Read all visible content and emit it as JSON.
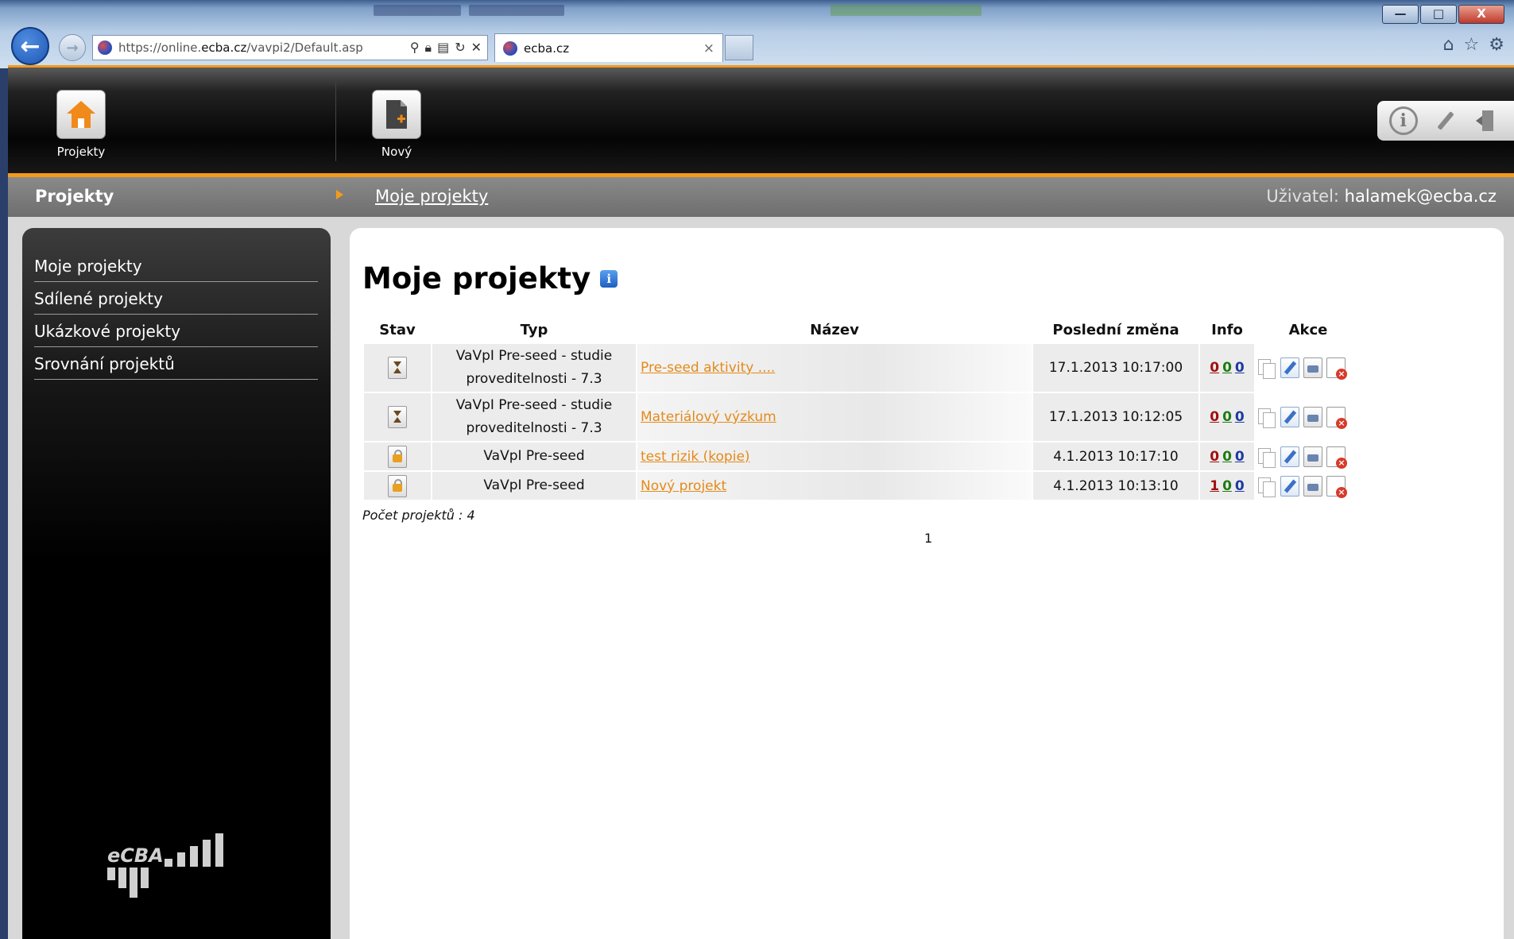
{
  "browser": {
    "url_prefix": "https://online.",
    "url_domain": "ecba.cz",
    "url_path": "/vavpi2/Default.asp",
    "tab_title": "ecba.cz",
    "tab_close": "×",
    "win_min": "—",
    "win_max": "□",
    "win_close": "X",
    "icons": [
      "home-icon",
      "star-icon",
      "gear-icon"
    ]
  },
  "header": {
    "projects_label": "Projekty",
    "new_label": "Nový"
  },
  "breadcrumb": {
    "section": "Projekty",
    "current": "Moje projekty",
    "user_label": "Uživatel:",
    "user_value": "halamek@ecba.cz"
  },
  "sidebar": {
    "items": [
      {
        "label": "Moje projekty"
      },
      {
        "label": "Sdílené projekty"
      },
      {
        "label": "Ukázkové projekty"
      },
      {
        "label": "Srovnání projektů"
      }
    ]
  },
  "main": {
    "title": "Moje projekty",
    "info_badge": "i",
    "columns": {
      "stav": "Stav",
      "typ": "Typ",
      "nazev": "Název",
      "date": "Poslední změna",
      "info": "Info",
      "akce": "Akce"
    },
    "rows": [
      {
        "stav": "hourglass",
        "typ": "VaVpI Pre-seed - studie proveditelnosti - 7.3",
        "nazev": "Pre-seed aktivity ....",
        "date": "17.1.2013 10:17:00",
        "info": [
          "0",
          "0",
          "0"
        ]
      },
      {
        "stav": "hourglass",
        "typ": "VaVpI Pre-seed - studie proveditelnosti - 7.3",
        "nazev": "Materiálový výzkum",
        "date": "17.1.2013 10:12:05",
        "info": [
          "0",
          "0",
          "0"
        ]
      },
      {
        "stav": "lock",
        "typ": "VaVpI Pre-seed",
        "nazev": "test rizik (kopie)",
        "date": "4.1.2013 10:17:10",
        "info": [
          "0",
          "0",
          "0"
        ]
      },
      {
        "stav": "lock",
        "typ": "VaVpI Pre-seed",
        "nazev": "Nový projekt",
        "date": "4.1.2013 10:13:10",
        "info": [
          "1",
          "0",
          "0"
        ]
      }
    ],
    "count_text": "Počet projektů : 4",
    "page": "1"
  },
  "colors": {
    "accent_orange": "#f39a1d",
    "info_red": "#a01010",
    "info_green": "#1e7a12",
    "info_blue": "#1c3aa0"
  }
}
